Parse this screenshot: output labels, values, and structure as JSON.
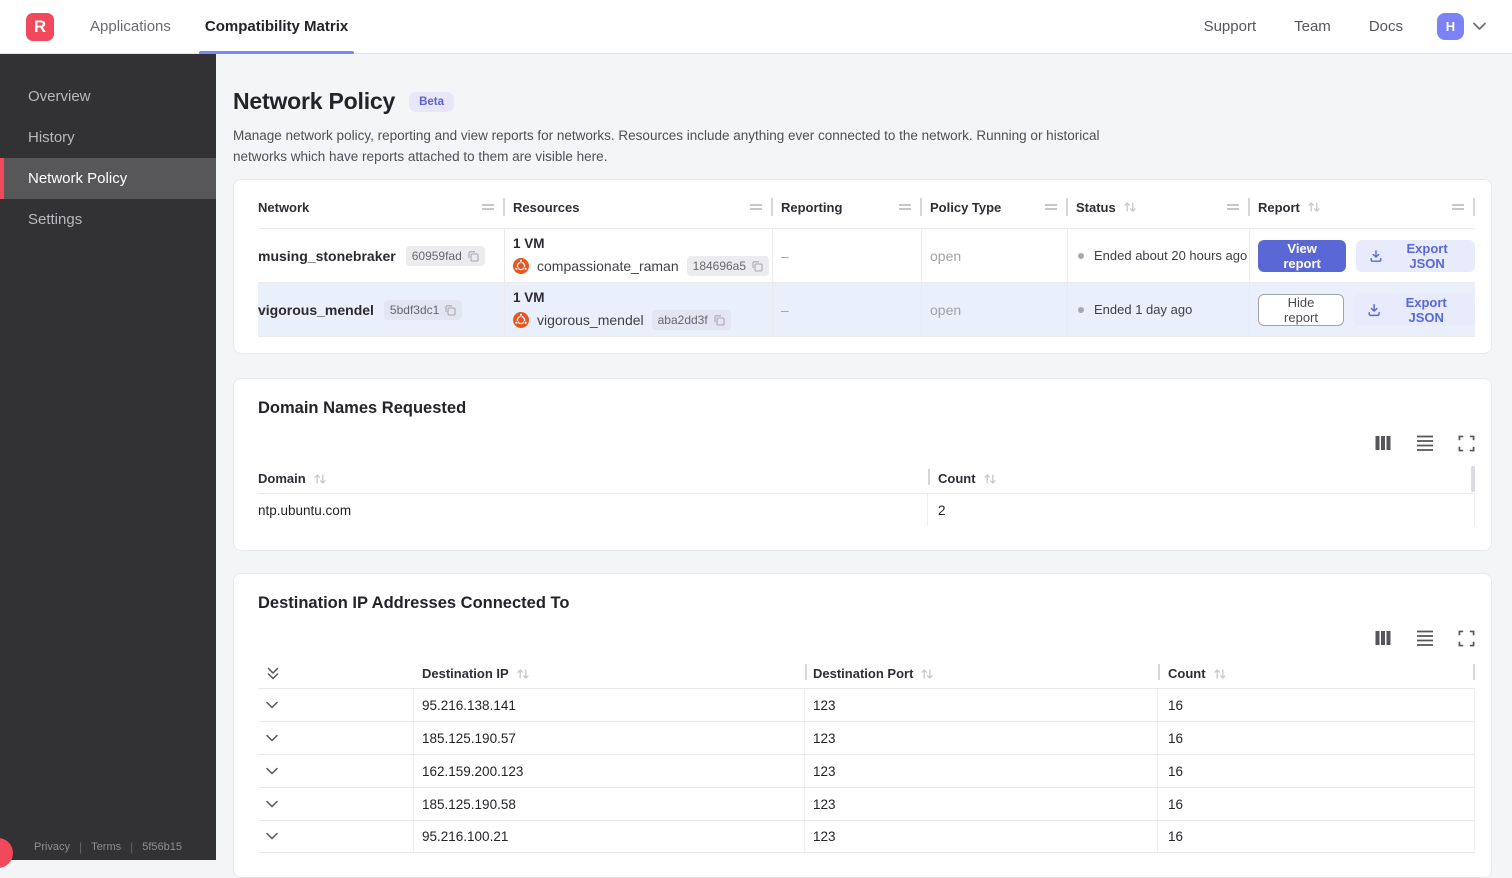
{
  "topbar": {
    "logo_letter": "R",
    "tabs": [
      {
        "label": "Applications"
      },
      {
        "label": "Compatibility Matrix"
      }
    ],
    "links": [
      {
        "label": "Support"
      },
      {
        "label": "Team"
      },
      {
        "label": "Docs"
      }
    ],
    "avatar_letter": "H"
  },
  "sidebar": {
    "items": [
      {
        "label": "Overview"
      },
      {
        "label": "History"
      },
      {
        "label": "Network Policy"
      },
      {
        "label": "Settings"
      }
    ],
    "footer": {
      "privacy": "Privacy",
      "terms": "Terms",
      "version": "5f56b15"
    }
  },
  "page": {
    "title": "Network Policy",
    "beta_badge": "Beta",
    "description": "Manage network policy, reporting and view reports for networks. Resources include anything ever connected to the network. Running or historical networks which have reports attached to them are visible here."
  },
  "network_table": {
    "columns": [
      "Network",
      "Resources",
      "Reporting",
      "Policy Type",
      "Status",
      "Report"
    ],
    "rows": [
      {
        "network": "musing_stonebraker",
        "network_id": "60959fad",
        "resources_count": "1 VM",
        "resource_name": "compassionate_raman",
        "resource_id": "184696a5",
        "reporting": "–",
        "policy_type": "open",
        "status": "Ended about 20 hours ago",
        "report_button": "View report",
        "export_button": "Export JSON"
      },
      {
        "network": "vigorous_mendel",
        "network_id": "5bdf3dc1",
        "resources_count": "1 VM",
        "resource_name": "vigorous_mendel",
        "resource_id": "aba2dd3f",
        "reporting": "–",
        "policy_type": "open",
        "status": "Ended 1 day ago",
        "report_button": "Hide report",
        "export_button": "Export JSON"
      }
    ]
  },
  "domain_card": {
    "title": "Domain Names Requested",
    "columns": [
      "Domain",
      "Count"
    ],
    "rows": [
      {
        "domain": "ntp.ubuntu.com",
        "count": "2"
      }
    ]
  },
  "destination_card": {
    "title": "Destination IP Addresses Connected To",
    "columns": [
      "Destination IP",
      "Destination Port",
      "Count"
    ],
    "rows": [
      {
        "ip": "95.216.138.141",
        "port": "123",
        "count": "16"
      },
      {
        "ip": "185.125.190.57",
        "port": "123",
        "count": "16"
      },
      {
        "ip": "162.159.200.123",
        "port": "123",
        "count": "16"
      },
      {
        "ip": "185.125.190.58",
        "port": "123",
        "count": "16"
      },
      {
        "ip": "95.216.100.21",
        "port": "123",
        "count": "16"
      }
    ]
  },
  "colors": {
    "brand_red": "#f1485b",
    "accent_indigo": "#5a68d5",
    "tab_underline": "#7b87f7",
    "avatar_bg": "#7b82f3",
    "selected_row": "#e9effb",
    "ubuntu_orange": "#e95420"
  }
}
